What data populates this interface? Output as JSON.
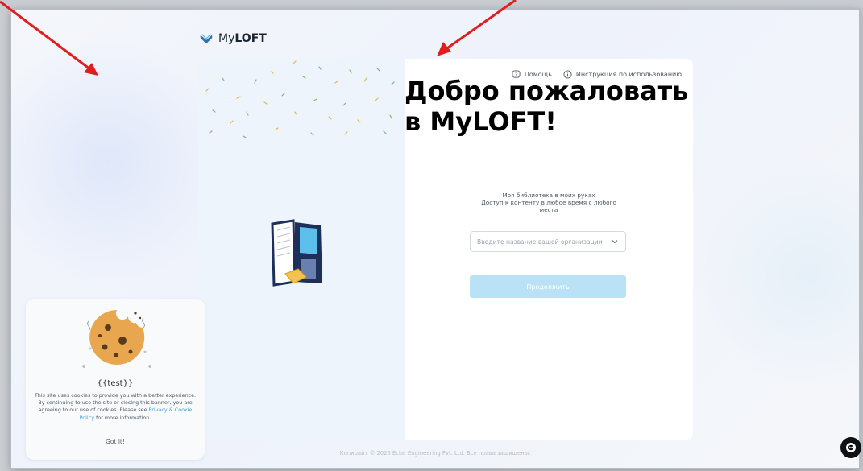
{
  "brand": {
    "prefix": "My",
    "name": "LOFT"
  },
  "topnav": {
    "help": "Помощь",
    "instructions": "Инструкция по использованию"
  },
  "welcome": {
    "title": "Добро пожаловать в MyLOFT!",
    "line1": "Моя библиотека в моих руках",
    "line2": "Доступ к контенту в любое время с любого",
    "line3": "места"
  },
  "org_select": {
    "placeholder": "Введите название вашей организации"
  },
  "continue_label": "Продолжить",
  "footer": "Копирайт © 2025 Eclat Engineering Pvt. Ltd. Все права защищены.",
  "cookie": {
    "title": "{{test}}",
    "text1": "This site uses cookies to provide you with a better experience. By continuing to use the site or closing this banner, you are agreeing to our use of cookies. Please see ",
    "link": "Privacy & Cookie Policy",
    "text2": " for more information.",
    "accept": "Got it!"
  },
  "icons": [
    "mylof-logo-icon",
    "help-icon",
    "info-icon",
    "chevron-down-icon",
    "cookie-icon",
    "chat-icon",
    "book-illustration",
    "arrow-annotation"
  ],
  "colors": {
    "accent": "#3aa3d9",
    "button": "#b9e2f6",
    "annotation": "#e01e1e"
  }
}
